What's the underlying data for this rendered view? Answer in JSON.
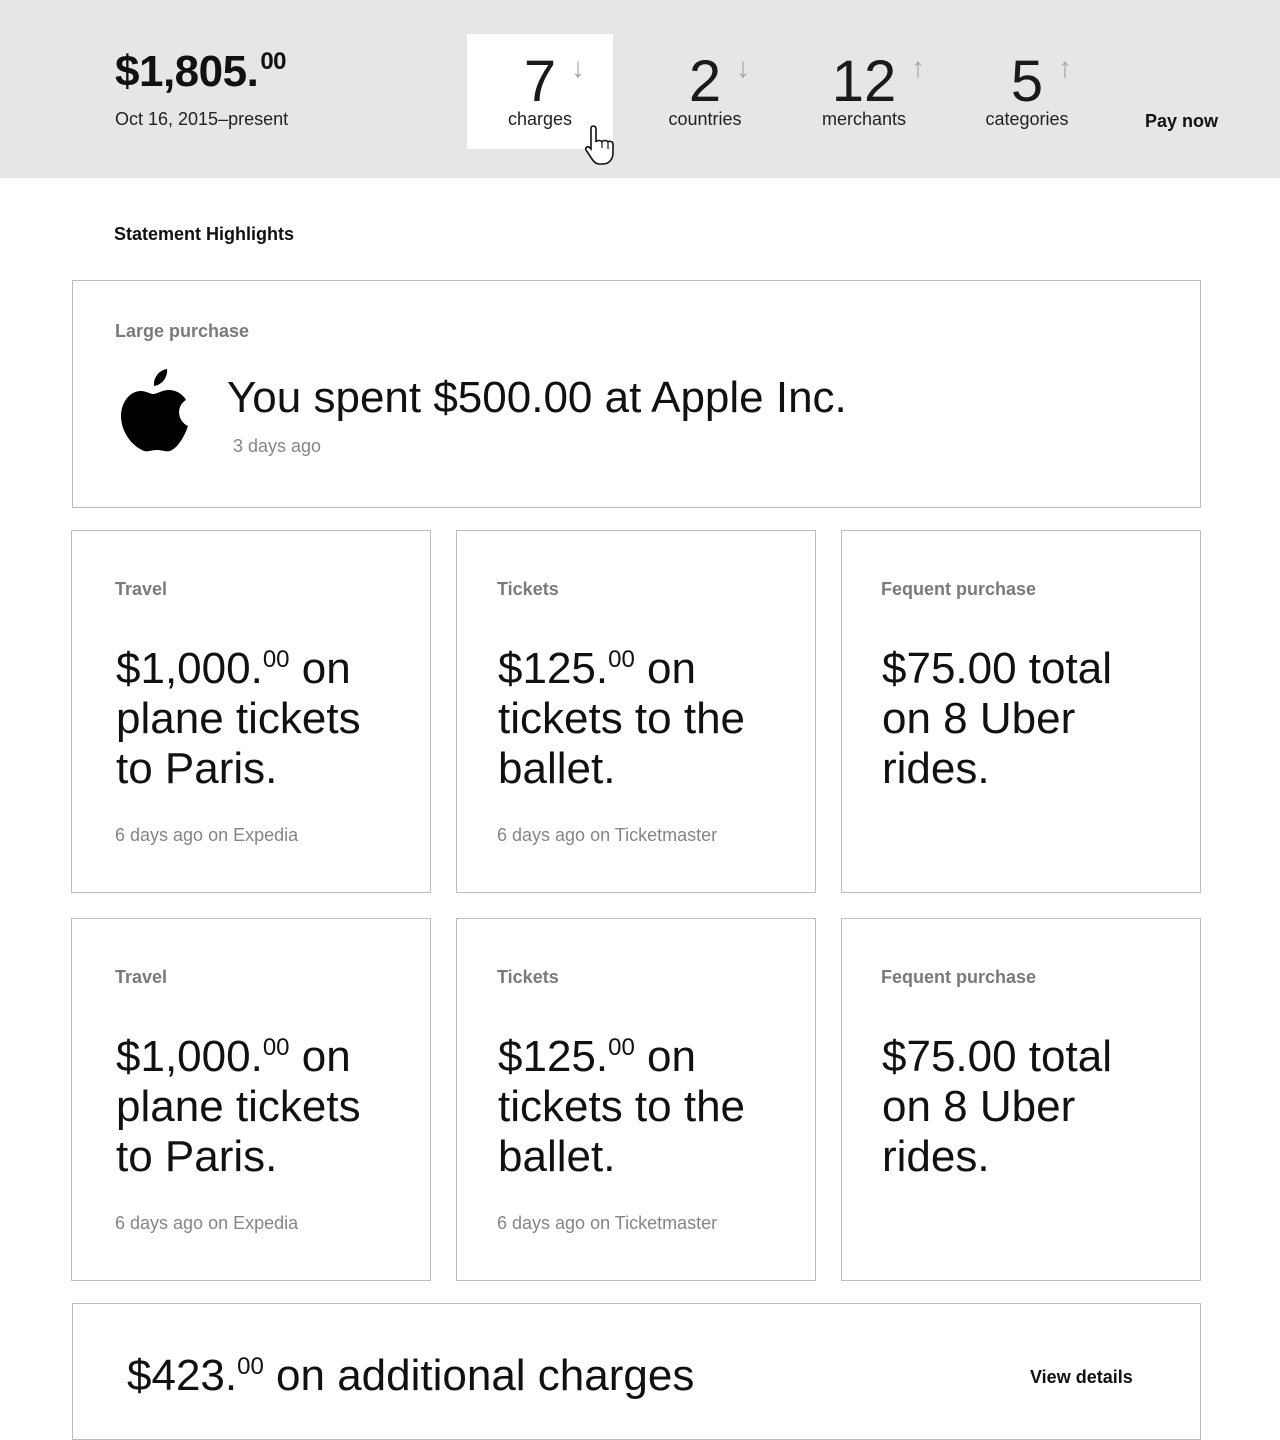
{
  "header": {
    "total_dollars": "$1,805.",
    "total_cents": "00",
    "period": "Oct 16, 2015–present",
    "pay_label": "Pay now",
    "stats": [
      {
        "value": "7",
        "label": "charges",
        "arrow": "↓",
        "trend": "down",
        "active": true
      },
      {
        "value": "2",
        "label": "countries",
        "arrow": "↓",
        "trend": "down",
        "active": false
      },
      {
        "value": "12",
        "label": "merchants",
        "arrow": "↑",
        "trend": "up",
        "active": false
      },
      {
        "value": "5",
        "label": "categories",
        "arrow": "↑",
        "trend": "up",
        "active": false
      }
    ]
  },
  "highlights": {
    "title": "Statement Highlights",
    "large_purchase": {
      "category": "Large purchase",
      "icon": "apple-logo",
      "text": "You spent $500.00 at Apple Inc.",
      "time": "3 days ago"
    },
    "rows": [
      [
        {
          "category": "Travel",
          "amount": "$1,000.",
          "cents": "00",
          "rest": " on",
          "line2": "plane tickets",
          "line3": "to Paris.",
          "meta": "6 days ago on Expedia"
        },
        {
          "category": "Tickets",
          "amount": "$125.",
          "cents": "00",
          "rest": " on",
          "line2": "tickets to the",
          "line3": "ballet.",
          "meta": "6 days ago on Ticketmaster"
        },
        {
          "category": "Fequent purchase",
          "amount": "$75.00 total",
          "cents": "",
          "rest": "",
          "line2": "on 8 Uber",
          "line3": "rides.",
          "meta": ""
        }
      ],
      [
        {
          "category": "Travel",
          "amount": "$1,000.",
          "cents": "00",
          "rest": " on",
          "line2": "plane tickets",
          "line3": "to Paris.",
          "meta": "6 days ago on Expedia"
        },
        {
          "category": "Tickets",
          "amount": "$125.",
          "cents": "00",
          "rest": " on",
          "line2": "tickets to the",
          "line3": "ballet.",
          "meta": "6 days ago on Ticketmaster"
        },
        {
          "category": "Fequent purchase",
          "amount": "$75.00 total",
          "cents": "",
          "rest": "",
          "line2": "on 8 Uber",
          "line3": "rides.",
          "meta": ""
        }
      ]
    ],
    "additional": {
      "amount": "$423.",
      "cents": "00",
      "rest": " on additional charges",
      "link": "View details"
    }
  }
}
